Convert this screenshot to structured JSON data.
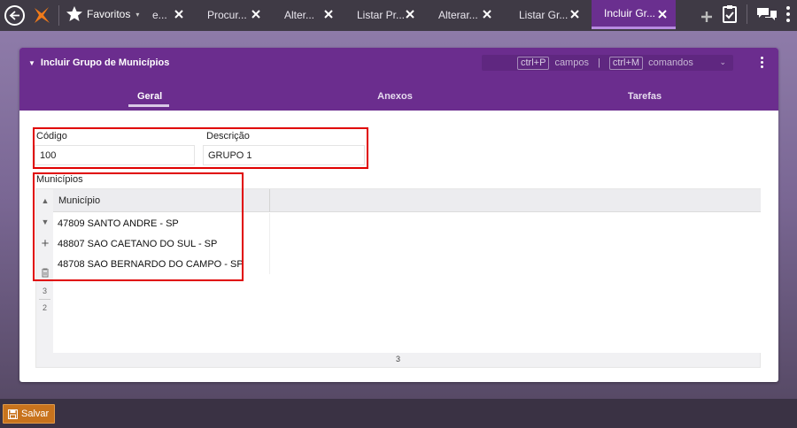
{
  "topbar": {
    "favorites_label": "Favoritos",
    "tabs": [
      {
        "label": "e..."
      },
      {
        "label": "Procur..."
      },
      {
        "label": "Alter..."
      },
      {
        "label": "Listar Pr..."
      },
      {
        "label": "Alterar..."
      },
      {
        "label": "Listar Gr..."
      },
      {
        "label": "Incluir Gr..."
      }
    ]
  },
  "panel": {
    "title": "Incluir Grupo de Municípios",
    "shortcuts": {
      "key1": "ctrl+P",
      "label1": "campos",
      "separator": "|",
      "key2": "ctrl+M",
      "label2": "comandos"
    },
    "subtabs": [
      "Geral",
      "Anexos",
      "Tarefas"
    ]
  },
  "form": {
    "codigo_label": "Código",
    "codigo_value": "100",
    "descricao_label": "Descrição",
    "descricao_value": "GRUPO 1",
    "municipios_label": "Municípios"
  },
  "grid": {
    "column_header": "Município",
    "rows": [
      "47809 SANTO ANDRE - SP",
      "48807 SAO CAETANO DO SUL - SP",
      "48708 SAO BERNARDO DO CAMPO - SP"
    ],
    "gutter_numbers": [
      "3",
      "2"
    ],
    "footer_count": "3"
  },
  "bottom": {
    "save_label": "Salvar"
  },
  "colors": {
    "header_purple": "#6b2d8e",
    "active_tab": "#6a2f8f",
    "highlight_red": "#e00000",
    "save_orange": "#c8731d"
  }
}
